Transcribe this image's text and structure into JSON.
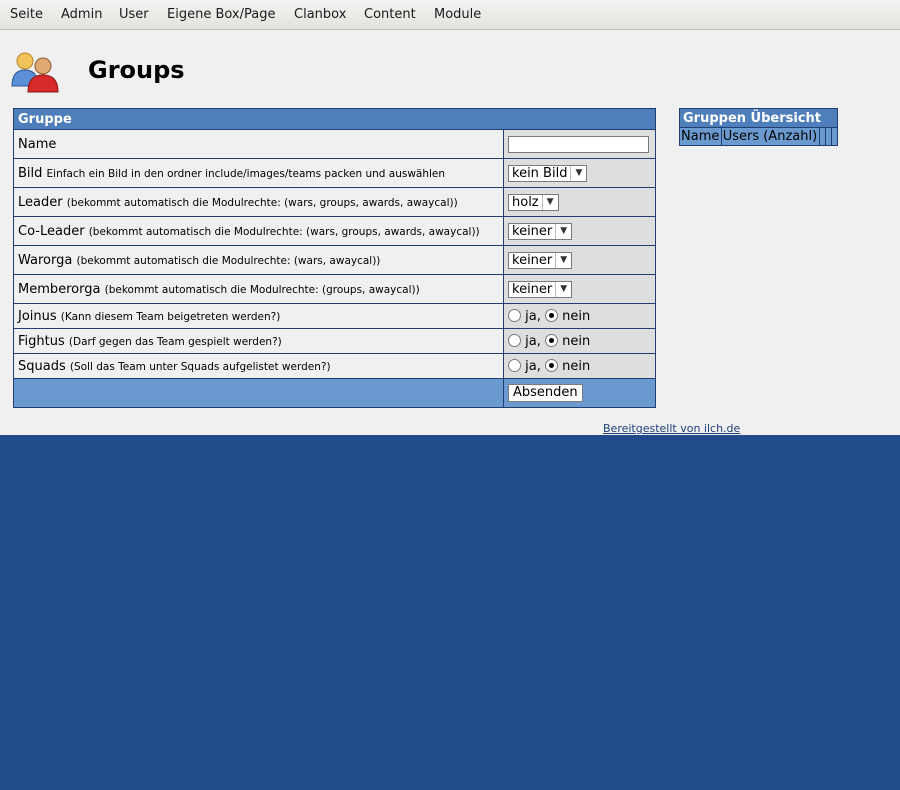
{
  "menu": {
    "items": [
      "Seite",
      "Admin",
      "User",
      "Eigene Box/Page",
      "Clanbox",
      "Content",
      "Module"
    ]
  },
  "page": {
    "title": "Groups",
    "icon": "users-group-icon"
  },
  "form": {
    "header": "Gruppe",
    "name_label": "Name",
    "name_value": "",
    "bild_label": "Bild",
    "bild_hint": "Einfach ein Bild in den ordner include/images/teams packen und auswählen",
    "bild_value": "kein Bild",
    "leader_label": "Leader",
    "leader_hint": "(bekommt automatisch die Modulrechte: (wars, groups, awards, awaycal))",
    "leader_value": "holz",
    "coleader_label": "Co-Leader",
    "coleader_hint": "(bekommt automatisch die Modulrechte: (wars, groups, awards, awaycal))",
    "coleader_value": "keiner",
    "warorga_label": "Warorga",
    "warorga_hint": "(bekommt automatisch die Modulrechte: (wars, awaycal))",
    "warorga_value": "keiner",
    "memberorga_label": "Memberorga",
    "memberorga_hint": "(bekommt automatisch die Modulrechte: (groups, awaycal))",
    "memberorga_value": "keiner",
    "joinus_label": "Joinus",
    "joinus_hint": "(Kann diesem Team beigetreten werden?)",
    "fightus_label": "Fightus",
    "fightus_hint": "(Darf gegen das Team gespielt werden?)",
    "squads_label": "Squads",
    "squads_hint": "(Soll das Team unter Squads aufgelistet werden?)",
    "yes_label": "ja,",
    "no_label": "nein",
    "submit_label": "Absenden"
  },
  "overview": {
    "header": "Gruppen Übersicht",
    "col_name": "Name",
    "col_users": "Users (Anzahl)"
  },
  "footer": {
    "link_text": "Bereitgestellt von ilch.de"
  },
  "colors": {
    "background": "#214b8b",
    "table_header": "#4f7fba",
    "table_footer": "#6b9ad0"
  }
}
